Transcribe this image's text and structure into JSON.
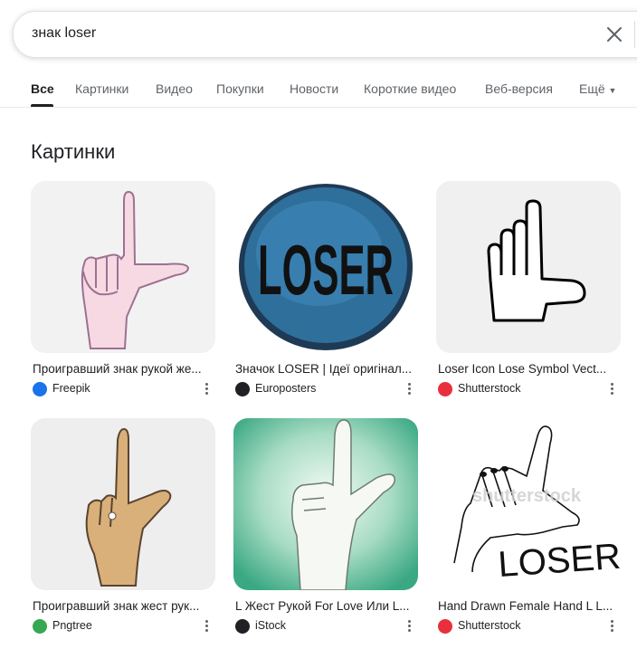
{
  "search": {
    "query": "знак loser"
  },
  "tabs": [
    {
      "label": "Все",
      "active": true
    },
    {
      "label": "Картинки"
    },
    {
      "label": "Видео"
    },
    {
      "label": "Покупки"
    },
    {
      "label": "Новости"
    },
    {
      "label": "Короткие видео"
    },
    {
      "label": "Веб-версия"
    },
    {
      "label": "Ещё"
    }
  ],
  "section": {
    "title": "Картинки"
  },
  "results": [
    {
      "caption": "Проигравший знак рукой же...",
      "source": "Freepik",
      "source_color": "#1a73e8",
      "image": "pink-hand-l-sign"
    },
    {
      "caption": "Значок LOSER | Ідеї оригінал...",
      "source": "Europosters",
      "source_color": "#202124",
      "image": "blue-loser-button"
    },
    {
      "caption": "Loser Icon Lose Symbol Vect...",
      "source": "Shutterstock",
      "source_color": "#e8303c",
      "image": "outline-l-hand-icon"
    },
    {
      "caption": "Проигравший знак жест рук...",
      "source": "Pngtree",
      "source_color": "#34a853",
      "image": "tan-hand-l-sign"
    },
    {
      "caption": "L Жест Рукой For Love Или L...",
      "source": "iStock",
      "source_color": "#202124",
      "image": "white-hand-on-teal"
    },
    {
      "caption": "Hand Drawn Female Hand L L...",
      "source": "Shutterstock",
      "source_color": "#e8303c",
      "image": "drawn-hand-loser-text"
    }
  ],
  "thumb_texts": {
    "loser_button": "LOSER",
    "loser_drawn": "LOSER!",
    "watermark": "shutterstock"
  },
  "colors": {
    "accent": "#202124",
    "muted": "#5f6368"
  }
}
